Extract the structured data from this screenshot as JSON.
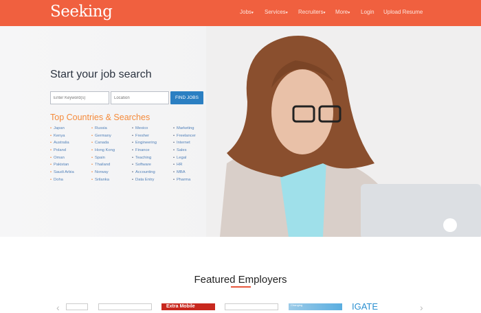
{
  "header": {
    "logo": "Seeking",
    "nav": [
      {
        "label": "Jobs",
        "dropdown": true
      },
      {
        "label": "Services",
        "dropdown": true
      },
      {
        "label": "Recruiters",
        "dropdown": true
      },
      {
        "label": "More",
        "dropdown": true
      },
      {
        "label": "Login",
        "dropdown": false
      },
      {
        "label": "Upload Resume",
        "dropdown": false
      }
    ]
  },
  "hero": {
    "title": "Start your job search",
    "keyword_placeholder": "Enter Keyword(s)",
    "location_placeholder": "Location",
    "find_button": "FIND JOBS",
    "subtitle": "Top Countries & Searches",
    "columns": [
      [
        "Japan",
        "Kenya",
        "Australia",
        "Poland",
        "Oman",
        "Pakistan",
        "Saudi Arbia",
        "Doha"
      ],
      [
        "Russia",
        "Germany",
        "Canada",
        "Hong Kong",
        "Spain",
        "Thailand",
        "Norway",
        "Srilanka"
      ],
      [
        "Mexico",
        "Fresher",
        "Engineering",
        "Finance",
        "Teaching",
        "Software",
        "Accounting",
        "Data Entry"
      ],
      [
        "Marketing",
        "Freelancer",
        "Internet",
        "Sales",
        "Legal",
        "HR",
        "MBA",
        "Pharma"
      ]
    ]
  },
  "featured": {
    "title": "Featured Employers",
    "logos": [
      "",
      "",
      "Extra Mobile",
      "",
      "Changing",
      "IGATE"
    ]
  },
  "colors": {
    "header": "#f0603f",
    "button": "#2b7fc2",
    "accent": "#f58a3a"
  }
}
